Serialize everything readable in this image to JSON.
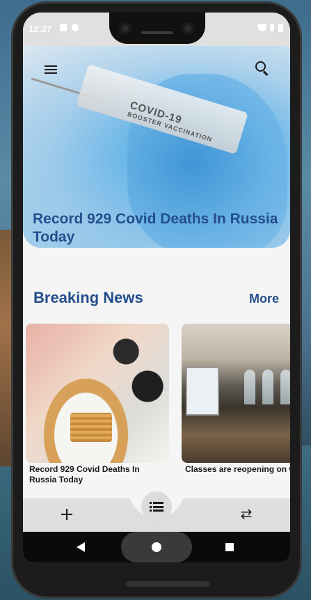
{
  "status_bar": {
    "time": "12:27"
  },
  "header": {
    "menu_icon": "hamburger-menu-icon",
    "search_icon": "search-icon"
  },
  "hero": {
    "vial_line1": "COVID-19",
    "vial_line2": "BOOSTER VACCINATION",
    "headline": "Record 929 Covid Deaths In Russia Today"
  },
  "breaking": {
    "title": "Breaking News",
    "more_label": "More",
    "cards": [
      {
        "title": "Record 929 Covid Deaths In Russia Today"
      },
      {
        "title": "Classes are reopening on week"
      }
    ]
  },
  "bottom_bar": {
    "add_icon": "plus-icon",
    "list_icon": "list-icon",
    "compare_icon": "compare-arrows-icon"
  },
  "colors": {
    "accent": "#234e8c",
    "screen_bg": "#f5f5f5",
    "bottom_bar_bg": "#dedede"
  }
}
